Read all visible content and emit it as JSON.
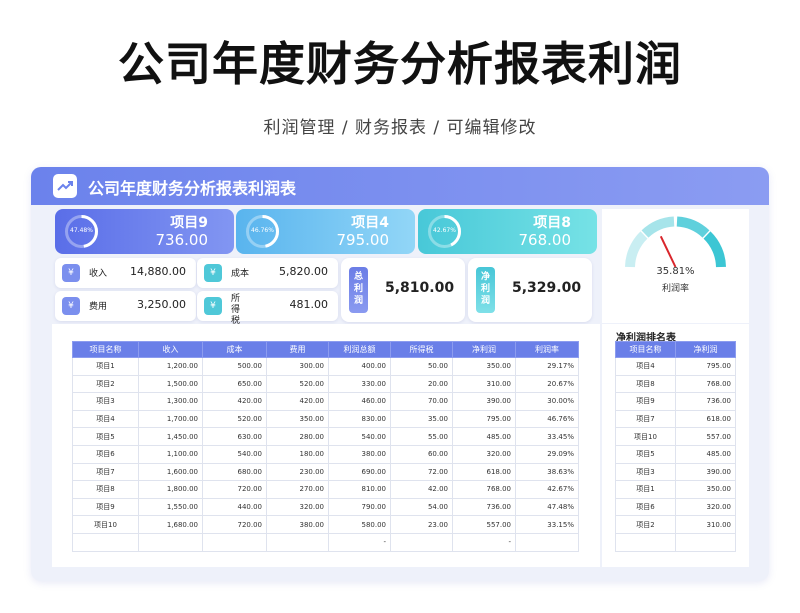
{
  "page": {
    "title": "公司年度财务分析报表利润",
    "subtitle": "利润管理 / 财务报表 / 可编辑修改"
  },
  "panel": {
    "title": "公司年度财务分析报表利润表",
    "header_icon": "trend-up-icon"
  },
  "kpis": [
    {
      "name": "项目9",
      "value": "736.00",
      "pct_label": "47.48%",
      "pct": 0.4748
    },
    {
      "name": "项目4",
      "value": "795.00",
      "pct_label": "46.76%",
      "pct": 0.4676
    },
    {
      "name": "项目8",
      "value": "768.00",
      "pct_label": "42.67%",
      "pct": 0.4267
    }
  ],
  "gauge": {
    "value": "35.81%",
    "fraction": 0.3581,
    "label": "利润率"
  },
  "mini_cards": [
    {
      "name": "收入",
      "value": "14,880.00",
      "icon": "money-cycle-icon"
    },
    {
      "name": "成本",
      "value": "5,820.00",
      "icon": "money-cycle-icon"
    },
    {
      "name": "费用",
      "value": "3,250.00",
      "icon": "money-cycle-icon"
    },
    {
      "name": "所得税",
      "value": "481.00",
      "icon": "money-cycle-icon"
    }
  ],
  "totals": [
    {
      "name": "总利润",
      "value": "5,810.00"
    },
    {
      "name": "净利润",
      "value": "5,329.00"
    }
  ],
  "main_table": {
    "headers": [
      "项目名称",
      "收入",
      "成本",
      "费用",
      "利润总额",
      "所得税",
      "净利润",
      "利润率"
    ],
    "rows": [
      [
        "项目1",
        "1,200.00",
        "500.00",
        "300.00",
        "400.00",
        "50.00",
        "350.00",
        "29.17%"
      ],
      [
        "项目2",
        "1,500.00",
        "650.00",
        "520.00",
        "330.00",
        "20.00",
        "310.00",
        "20.67%"
      ],
      [
        "项目3",
        "1,300.00",
        "420.00",
        "420.00",
        "460.00",
        "70.00",
        "390.00",
        "30.00%"
      ],
      [
        "项目4",
        "1,700.00",
        "520.00",
        "350.00",
        "830.00",
        "35.00",
        "795.00",
        "46.76%"
      ],
      [
        "项目5",
        "1,450.00",
        "630.00",
        "280.00",
        "540.00",
        "55.00",
        "485.00",
        "33.45%"
      ],
      [
        "项目6",
        "1,100.00",
        "540.00",
        "180.00",
        "380.00",
        "60.00",
        "320.00",
        "29.09%"
      ],
      [
        "项目7",
        "1,600.00",
        "680.00",
        "230.00",
        "690.00",
        "72.00",
        "618.00",
        "38.63%"
      ],
      [
        "项目8",
        "1,800.00",
        "720.00",
        "270.00",
        "810.00",
        "42.00",
        "768.00",
        "42.67%"
      ],
      [
        "项目9",
        "1,550.00",
        "440.00",
        "320.00",
        "790.00",
        "54.00",
        "736.00",
        "47.48%"
      ],
      [
        "项目10",
        "1,680.00",
        "720.00",
        "380.00",
        "580.00",
        "23.00",
        "557.00",
        "33.15%"
      ],
      [
        "",
        "",
        "",
        "",
        "-",
        "",
        "-",
        ""
      ]
    ]
  },
  "rank_table": {
    "title": "净利润排名表",
    "headers": [
      "项目名称",
      "净利润"
    ],
    "rows": [
      [
        "项目4",
        "795.00"
      ],
      [
        "项目8",
        "768.00"
      ],
      [
        "项目9",
        "736.00"
      ],
      [
        "项目7",
        "618.00"
      ],
      [
        "项目10",
        "557.00"
      ],
      [
        "项目5",
        "485.00"
      ],
      [
        "项目3",
        "390.00"
      ],
      [
        "项目1",
        "350.00"
      ],
      [
        "项目6",
        "320.00"
      ],
      [
        "项目2",
        "310.00"
      ],
      [
        "",
        ""
      ]
    ]
  },
  "colors": {
    "accent": "#6a7fe8",
    "kpi_blue": "#5a6ee8",
    "kpi_sky": "#59b4ee",
    "kpi_teal": "#48c8d8",
    "gauge_needle": "#d9262c"
  }
}
